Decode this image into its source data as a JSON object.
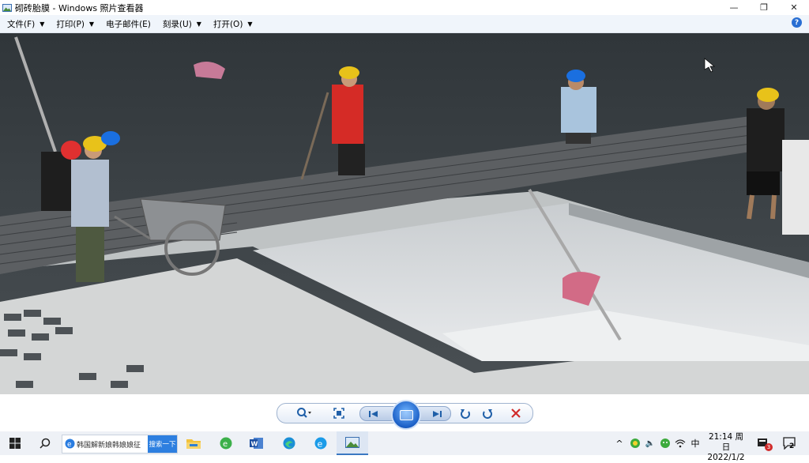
{
  "window": {
    "title": "砌砖胎膜 - Windows 照片查看器",
    "controls": {
      "minimize": "—",
      "restore": "❐",
      "close": "✕"
    }
  },
  "menu": {
    "items": [
      {
        "label": "文件(F)",
        "has_arrow": true
      },
      {
        "label": "打印(P)",
        "has_arrow": true
      },
      {
        "label": "电子邮件(E)",
        "has_arrow": false
      },
      {
        "label": "刻录(U)",
        "has_arrow": true
      },
      {
        "label": "打开(O)",
        "has_arrow": true
      }
    ],
    "help": "?"
  },
  "photo": {
    "description_icon": "construction-photo",
    "helmet_colors": [
      "#e8c21a",
      "#1a6fe0",
      "#e03030"
    ]
  },
  "viewer_toolbar": {
    "zoom_icon": "zoom-icon",
    "fit_icon": "fit-to-window-icon",
    "prev_icon": "previous-icon",
    "slideshow_icon": "slideshow-icon",
    "next_icon": "next-icon",
    "rotate_ccw_icon": "rotate-ccw-icon",
    "rotate_cw_icon": "rotate-cw-icon",
    "delete_icon": "delete-icon"
  },
  "taskbar": {
    "search_text": "韩国解新娘韩娘娘征",
    "search_button": "搜索一下",
    "ime": "中",
    "clock": {
      "time": "21:14 周日",
      "date": "2022/1/2"
    },
    "notification_count": "2",
    "badge_count": "3"
  },
  "colors": {
    "accent": "#2a6fd3",
    "delete_red": "#d12b2b",
    "menubar_bg": "#f0f5fb"
  }
}
